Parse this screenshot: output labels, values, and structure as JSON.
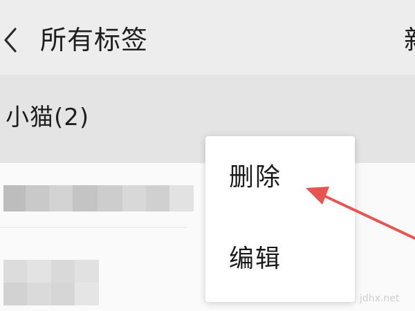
{
  "header": {
    "title": "所有标签",
    "new_label": "新",
    "back_icon": "chevron-left-icon"
  },
  "tag_group": {
    "label": "小猫(2)"
  },
  "popup_menu": {
    "items": [
      {
        "label": "删除"
      },
      {
        "label": "编辑"
      }
    ]
  },
  "annotation": {
    "color": "#e8544f"
  },
  "watermark": "jdhx.net",
  "colors": {
    "header_bg": "#ededed",
    "tag_row_bg": "#e4e4e4",
    "content_bg": "#fafafa",
    "popup_bg": "#ffffff"
  }
}
